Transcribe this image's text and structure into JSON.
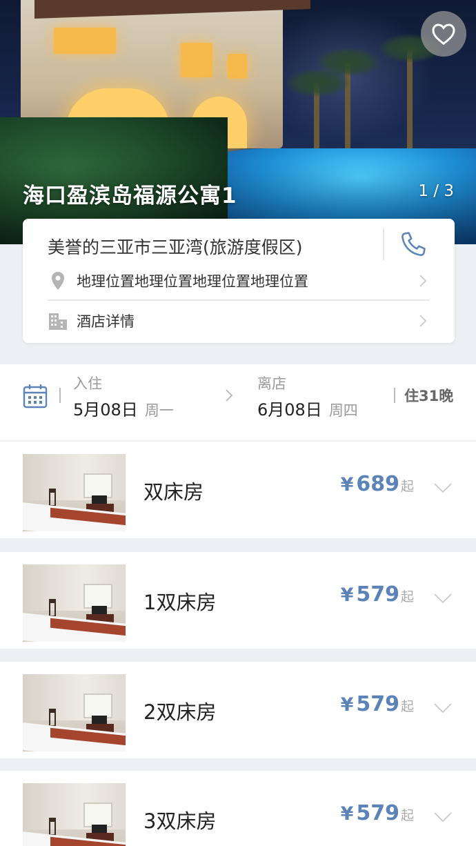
{
  "hero": {
    "title": "海口盈滨岛福源公寓1",
    "photo_counter": "1 / 3",
    "favorite_icon": "heart-outline-icon"
  },
  "info_card": {
    "hotel_name": "美誉的三亚市三亚湾(旅游度假区)",
    "phone_icon": "phone-icon",
    "location_text": "地理位置地理位置地理位置地理位置",
    "location_icon": "map-pin-icon",
    "details_text": "酒店详情",
    "details_icon": "building-icon"
  },
  "dates": {
    "calendar_icon": "calendar-icon",
    "checkin_label": "入住",
    "checkin_date": "5月08日",
    "checkin_weekday": "周一",
    "checkout_label": "离店",
    "checkout_date": "6月08日",
    "checkout_weekday": "周四",
    "nights": "住31晚"
  },
  "rooms": [
    {
      "name": "双床房",
      "currency": "¥",
      "price": "689",
      "suffix": "起"
    },
    {
      "name": "1双床房",
      "currency": "¥",
      "price": "579",
      "suffix": "起"
    },
    {
      "name": "2双床房",
      "currency": "¥",
      "price": "579",
      "suffix": "起"
    },
    {
      "name": "3双床房",
      "currency": "¥",
      "price": "579",
      "suffix": "起"
    }
  ],
  "colors": {
    "accent": "#5b83b8",
    "page_bg": "#eceff3"
  }
}
